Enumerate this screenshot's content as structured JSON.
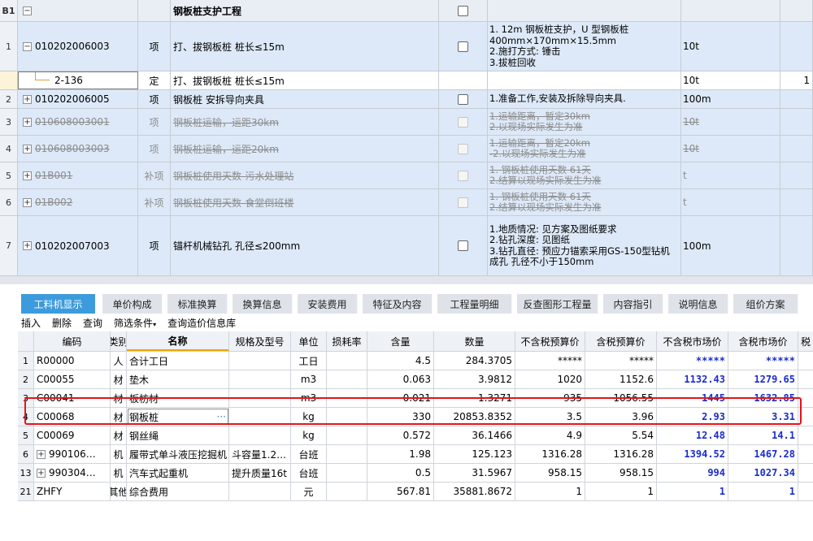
{
  "section": {
    "id": "B1",
    "name": "钢板桩支护工程"
  },
  "rows": [
    {
      "num": "1",
      "code": "010202006003",
      "cat": "项",
      "name": "打、拔钢板桩 桩长≤15m",
      "feature": [
        "1. 12m 钢板桩支护，U 型钢板桩",
        "400mm×170mm×15.5mm",
        "2.施打方式: 锤击",
        "3.拔桩回收"
      ],
      "unit": "10t"
    },
    {
      "num": "",
      "code": "2-136",
      "cat": "定",
      "name": "打、拔钢板桩 桩长≤15m",
      "feature": [],
      "unit": "10t",
      "last": "1"
    },
    {
      "num": "2",
      "code": "010202006005",
      "cat": "项",
      "name": "钢板桩 安拆导向夹具",
      "feature": [
        "1.准备工作,安装及拆除导向夹具."
      ],
      "unit": "100m"
    },
    {
      "num": "3",
      "code": "010608003001",
      "cat": "项",
      "name": "钢板桩运输，运距30km",
      "feature": [
        "1.运输距离，暂定30km",
        "2.以现场实际发生为准"
      ],
      "unit": "10t"
    },
    {
      "num": "4",
      "code": "010608003003",
      "cat": "项",
      "name": "钢板桩运输，运距20km",
      "feature": [
        "1.运输距离，暂定20km",
        "-2.以现场实际发生为准"
      ],
      "unit": "10t"
    },
    {
      "num": "5",
      "code": "01B001",
      "cat": "补项",
      "name": "钢板桩使用天数-污水处理站",
      "feature": [
        "1.  钢板桩使用天数  61天",
        "2.结算以现场实际发生为准"
      ],
      "unit": "t"
    },
    {
      "num": "6",
      "code": "01B002",
      "cat": "补项",
      "name": "钢板桩使用天数-食堂倒班楼",
      "feature": [
        "1.  钢板桩使用天数  61天",
        "2.结算以现场实际发生为准"
      ],
      "unit": "t"
    },
    {
      "num": "7",
      "code": "010202007003",
      "cat": "项",
      "name": "锚杆机械钻孔 孔径≤200mm",
      "feature": [
        "1.地质情况: 见方案及图纸要求",
        "2.钻孔深度: 见图纸",
        "3.钻孔直径: 预应力锚索采用GS-150型钻机",
        "成孔 孔径不小于150mm"
      ],
      "unit": "100m"
    }
  ],
  "tabs": [
    "工料机显示",
    "单价构成",
    "标准换算",
    "换算信息",
    "安装费用",
    "特征及内容",
    "工程量明细",
    "反查图形工程量",
    "内容指引",
    "说明信息",
    "组价方案"
  ],
  "toolbar": [
    "插入",
    "删除",
    "查询",
    "筛选条件",
    "查询造价信息库"
  ],
  "columns": [
    "编码",
    "类别",
    "名称",
    "规格及型号",
    "单位",
    "损耗率",
    "含量",
    "数量",
    "不含税预算价",
    "含税预算价",
    "不含税市场价",
    "含税市场价",
    "税"
  ],
  "materials": [
    {
      "num": "1",
      "code": "R00000",
      "cat": "人",
      "name": "合计工日",
      "spec": "",
      "unit": "工日",
      "qty": "4.5",
      "total": "284.3705",
      "p1": "*****",
      "p2": "*****",
      "p3": "*****",
      "p4": "*****"
    },
    {
      "num": "2",
      "code": "C00055",
      "cat": "材",
      "name": "垫木",
      "spec": "",
      "unit": "m3",
      "qty": "0.063",
      "total": "3.9812",
      "p1": "1020",
      "p2": "1152.6",
      "p3": "1132.43",
      "p4": "1279.65"
    },
    {
      "num": "3",
      "code": "C00041",
      "cat": "材",
      "name": "板枋材",
      "spec": "",
      "unit": "m3",
      "qty": "0.021",
      "total": "1.3271",
      "p1": "935",
      "p2": "1056.55",
      "p3": "1445",
      "p4": "1632.85"
    },
    {
      "num": "4",
      "code": "C00068",
      "cat": "材",
      "name": "钢板桩",
      "spec": "",
      "unit": "kg",
      "qty": "330",
      "total": "20853.8352",
      "p1": "3.5",
      "p2": "3.96",
      "p3": "2.93",
      "p4": "3.31"
    },
    {
      "num": "5",
      "code": "C00069",
      "cat": "材",
      "name": "钢丝绳",
      "spec": "",
      "unit": "kg",
      "qty": "0.572",
      "total": "36.1466",
      "p1": "4.9",
      "p2": "5.54",
      "p3": "12.48",
      "p4": "14.1"
    },
    {
      "num": "6",
      "code": "990106…",
      "cat": "机",
      "name": "履带式单斗液压挖掘机",
      "spec": "斗容量1.2…",
      "unit": "台班",
      "qty": "1.98",
      "total": "125.123",
      "p1": "1316.28",
      "p2": "1316.28",
      "p3": "1394.52",
      "p4": "1467.28"
    },
    {
      "num": "13",
      "code": "990304…",
      "cat": "机",
      "name": "汽车式起重机",
      "spec": "提升质量16t",
      "unit": "台班",
      "qty": "0.5",
      "total": "31.5967",
      "p1": "958.15",
      "p2": "958.15",
      "p3": "994",
      "p4": "1027.34"
    },
    {
      "num": "21",
      "code": "ZHFY",
      "cat": "其他",
      "name": "综合费用",
      "spec": "",
      "unit": "元",
      "qty": "567.81",
      "total": "35881.8672",
      "p1": "1",
      "p2": "1",
      "p3": "1",
      "p4": "1"
    }
  ],
  "name_edit_glyph": "···"
}
